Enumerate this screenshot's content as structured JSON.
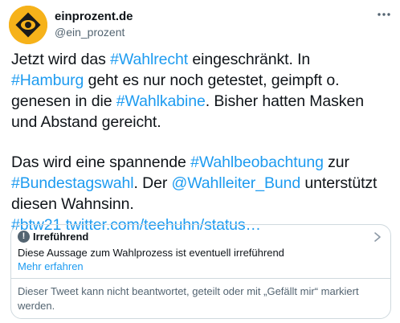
{
  "author": {
    "display_name": "einprozent.de",
    "handle": "@ein_prozent",
    "avatar_icon": "eye-logo-icon",
    "avatar_color": "#f6b21a"
  },
  "more_icon": "more-icon",
  "text": {
    "l1a": "Jetzt wird das ",
    "l1tag": "#Wahlrecht",
    "l1b": " eingeschränkt. In",
    "l2tag": "#Hamburg",
    "l2b": " geht es nur noch getestet, geimpft o.",
    "l3a": "genesen in die ",
    "l3tag": "#Wahlkabine",
    "l3b": ". Bisher hatten Masken",
    "l4": "und Abstand gereicht.",
    "l5a": "Das wird eine spannende ",
    "l5tag": "#Wahlbeobachtung",
    "l5b": " zur",
    "l6tag": "#Bundestagswahl",
    "l6b": ". Der ",
    "l6mention": "@Wahlleiter_Bund",
    "l6c": " unterstützt",
    "l7": "diesen Wahnsinn.",
    "l8tag": "#btw21",
    "l8link": "twitter.com/teehuhn/status…"
  },
  "notice": {
    "icon": "warning-icon",
    "title": "Irreführend",
    "description": "Diese Aussage zum Wahlprozess ist eventuell irreführend",
    "learn_more": "Mehr erfahren",
    "reply_note": "Dieser Tweet kann nicht beantwortet, geteilt oder mit „Gefällt mir“ markiert werden."
  },
  "colors": {
    "link": "#1d9bf0",
    "text": "#0f1419",
    "muted": "#536471",
    "border": "#cfd9de"
  }
}
